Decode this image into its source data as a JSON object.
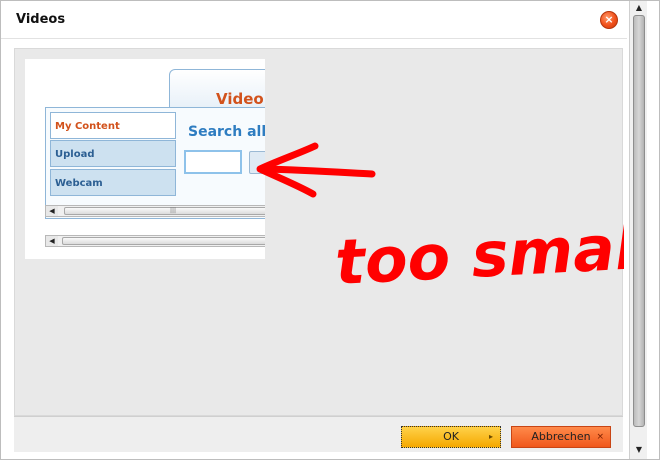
{
  "dialog": {
    "title": "Videos",
    "close_symbol": "×",
    "ok_label": "OK",
    "ok_arrow": "▸",
    "cancel_label": "Abbrechen",
    "cancel_symbol": "×"
  },
  "preview": {
    "tab_label": "Video",
    "sidebar": [
      {
        "label": "My Content",
        "active": true
      },
      {
        "label": "Upload",
        "active": false
      },
      {
        "label": "Webcam",
        "active": false
      }
    ],
    "search_heading": "Search all v"
  },
  "annotation": {
    "text": "too small",
    "color": "#ff0000"
  },
  "icons": {
    "close": "close-icon",
    "ok_arrow": "arrow-right-icon",
    "cancel": "close-icon",
    "scroll_left": "arrow-left-icon",
    "scroll_up": "chevron-up-icon",
    "scroll_down": "chevron-down-icon"
  },
  "colors": {
    "accent_orange": "#d2521c",
    "ok_yellow": "#f5a800",
    "cancel_orange": "#f0571b",
    "link_blue": "#2f7dc1"
  }
}
